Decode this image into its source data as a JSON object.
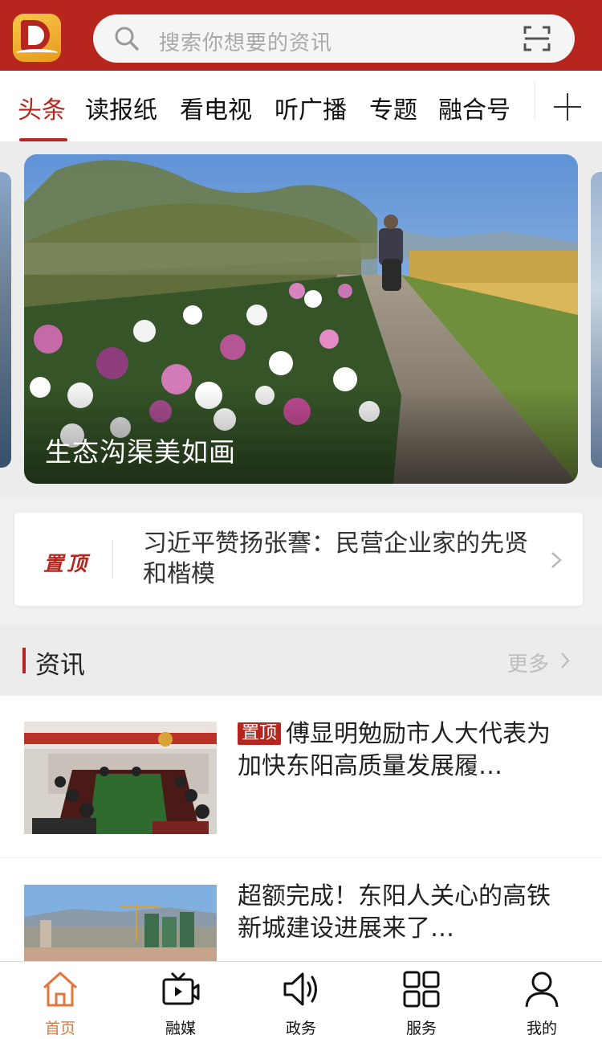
{
  "header": {
    "search_placeholder": "搜索你想要的资讯",
    "icons": {
      "logo": "app-logo",
      "search": "search-icon",
      "scan": "scan-icon"
    },
    "brand_color": "#b7251f"
  },
  "tabs": {
    "items": [
      {
        "label": "头条",
        "active": true
      },
      {
        "label": "读报纸",
        "active": false
      },
      {
        "label": "看电视",
        "active": false
      },
      {
        "label": "听广播",
        "active": false
      },
      {
        "label": "专题",
        "active": false
      },
      {
        "label": "融合号",
        "active": false
      }
    ],
    "add_icon": "plus-icon"
  },
  "banner": {
    "title": "生态沟渠美如画"
  },
  "pinned": {
    "badge_logo_text": "置顶",
    "headline": "习近平赞扬张謇：民营企业家的先贤和楷模",
    "arrow_icon": "chevron-right-icon"
  },
  "section": {
    "title": "资讯",
    "more_label": "更多"
  },
  "news": [
    {
      "badge": "置顶",
      "title": "傅显明勉励市人大代表为加快东阳高质量发展履…"
    },
    {
      "badge": "",
      "title": "超额完成！东阳人关心的高铁新城建设进展来了…"
    }
  ],
  "bottom_nav": {
    "items": [
      {
        "label": "首页",
        "icon": "home-icon",
        "active": true
      },
      {
        "label": "融媒",
        "icon": "media-tv-icon",
        "active": false
      },
      {
        "label": "政务",
        "icon": "speaker-icon",
        "active": false
      },
      {
        "label": "服务",
        "icon": "grid-icon",
        "active": false
      },
      {
        "label": "我的",
        "icon": "user-icon",
        "active": false
      }
    ],
    "active_color": "#e2763b"
  }
}
